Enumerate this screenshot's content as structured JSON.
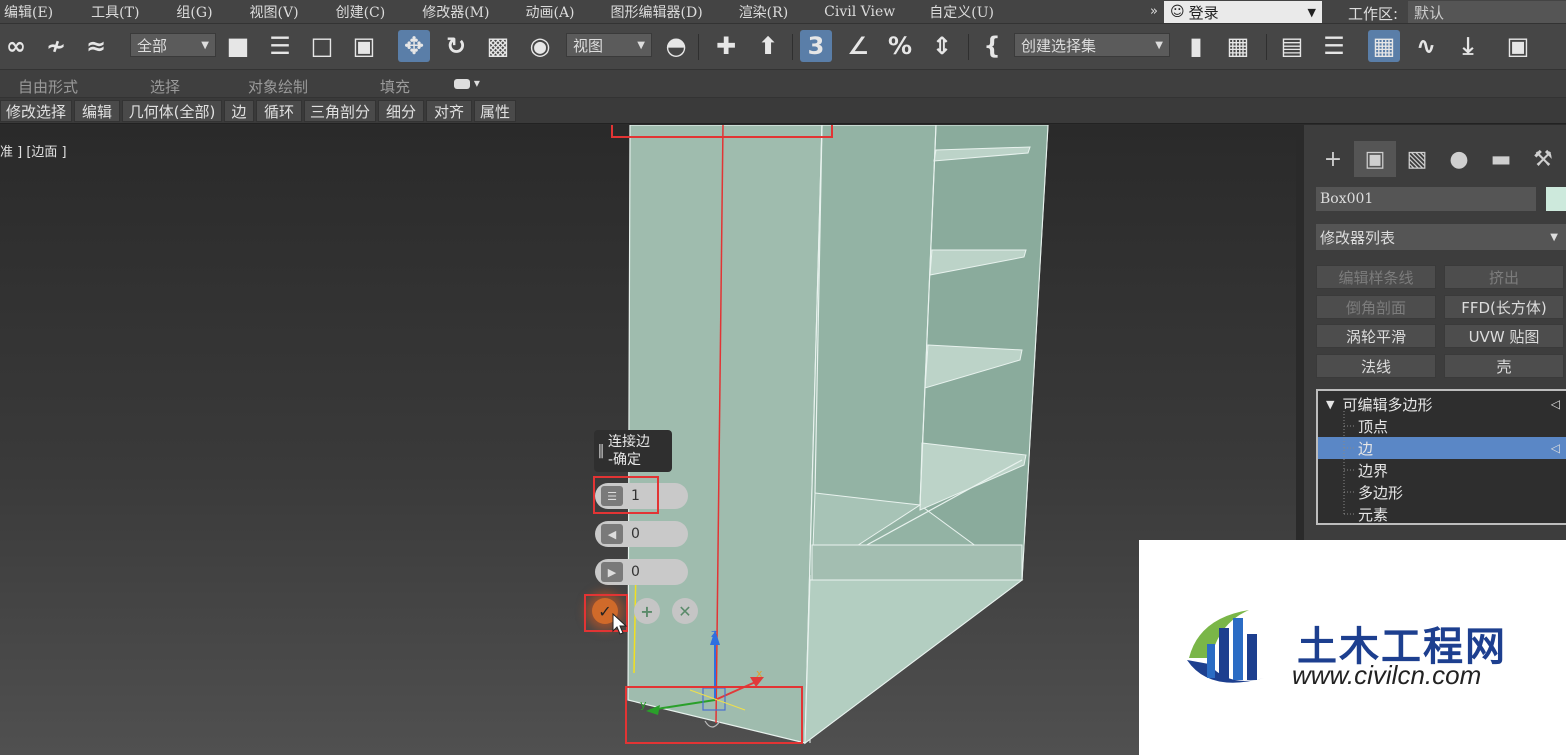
{
  "menu": {
    "items": [
      "编辑(E)",
      "工具(T)",
      "组(G)",
      "视图(V)",
      "创建(C)",
      "修改器(M)",
      "动画(A)",
      "图形编辑器(D)",
      "渲染(R)",
      "Civil View",
      "自定义(U)"
    ],
    "more": "»"
  },
  "account": {
    "login": "登录"
  },
  "workspace": {
    "label": "工作区:",
    "value": "默认"
  },
  "toolbar": {
    "filter_value": "全部",
    "ref_coord_value": "视图",
    "selection_set_value": "创建选择集"
  },
  "ribbon": {
    "tabs": [
      "自由形式",
      "选择",
      "对象绘制",
      "填充"
    ],
    "sub_items": [
      "修改选择",
      "编辑",
      "几何体(全部)",
      "边",
      "循环",
      "三角剖分",
      "细分",
      "对齐",
      "属性"
    ]
  },
  "viewport": {
    "label": "准 ] [边面 ]",
    "caddy": {
      "title_line1": "连接边",
      "title_line2": "-确定",
      "segments_value": "1",
      "pinch_value": "0",
      "slide_value": "0"
    },
    "axis": {
      "x": "x",
      "y": "y",
      "z": "z"
    }
  },
  "command_panel": {
    "object_name": "Box001",
    "object_color": "#cde9dc",
    "modifier_list": "修改器列表",
    "buttons": [
      {
        "label": "编辑样条线",
        "enabled": false
      },
      {
        "label": "挤出",
        "enabled": false
      },
      {
        "label": "倒角剖面",
        "enabled": false
      },
      {
        "label": "FFD(长方体)",
        "enabled": true
      },
      {
        "label": "涡轮平滑",
        "enabled": true
      },
      {
        "label": "UVW 贴图",
        "enabled": true
      },
      {
        "label": "法线",
        "enabled": true
      },
      {
        "label": "壳",
        "enabled": true
      }
    ],
    "stack": {
      "root": "可编辑多边形",
      "subobjects": [
        "顶点",
        "边",
        "边界",
        "多边形",
        "元素"
      ],
      "selected": "边"
    }
  },
  "watermark": {
    "name": "土木工程网",
    "url": "www.civilcn.com"
  }
}
